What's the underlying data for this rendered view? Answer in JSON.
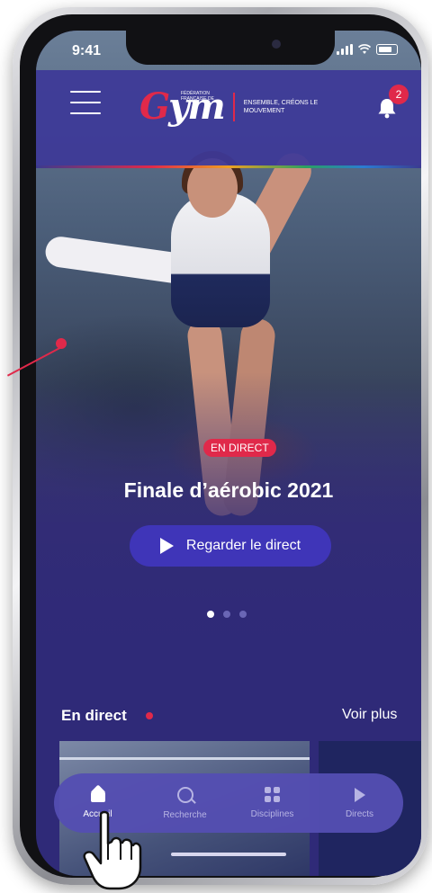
{
  "status_bar": {
    "time": "9:41"
  },
  "header": {
    "logo_small": "FÉDÉRATION FRANÇAISE DE",
    "logo_mark": "Gym",
    "logo_tagline": "ENSEMBLE, CRÉONS LE MOUVEMENT",
    "notification_count": "2"
  },
  "hero": {
    "badge": "EN DIRECT",
    "title": "Finale d’aérobic 2021",
    "button_label": "Regarder le direct",
    "carousel": {
      "pages": 3,
      "active": 1
    }
  },
  "section": {
    "title": "En direct",
    "more_label": "Voir plus"
  },
  "nav": {
    "items": [
      {
        "label": "Accueil",
        "icon": "home-icon",
        "active": true
      },
      {
        "label": "Recherche",
        "icon": "search-icon",
        "active": false
      },
      {
        "label": "Disciplines",
        "icon": "grid-icon",
        "active": false
      },
      {
        "label": "Directs",
        "icon": "play-icon",
        "active": false
      }
    ]
  },
  "colors": {
    "primary": "#2f2a78",
    "accent": "#e0294a",
    "button": "#3f35b8"
  }
}
